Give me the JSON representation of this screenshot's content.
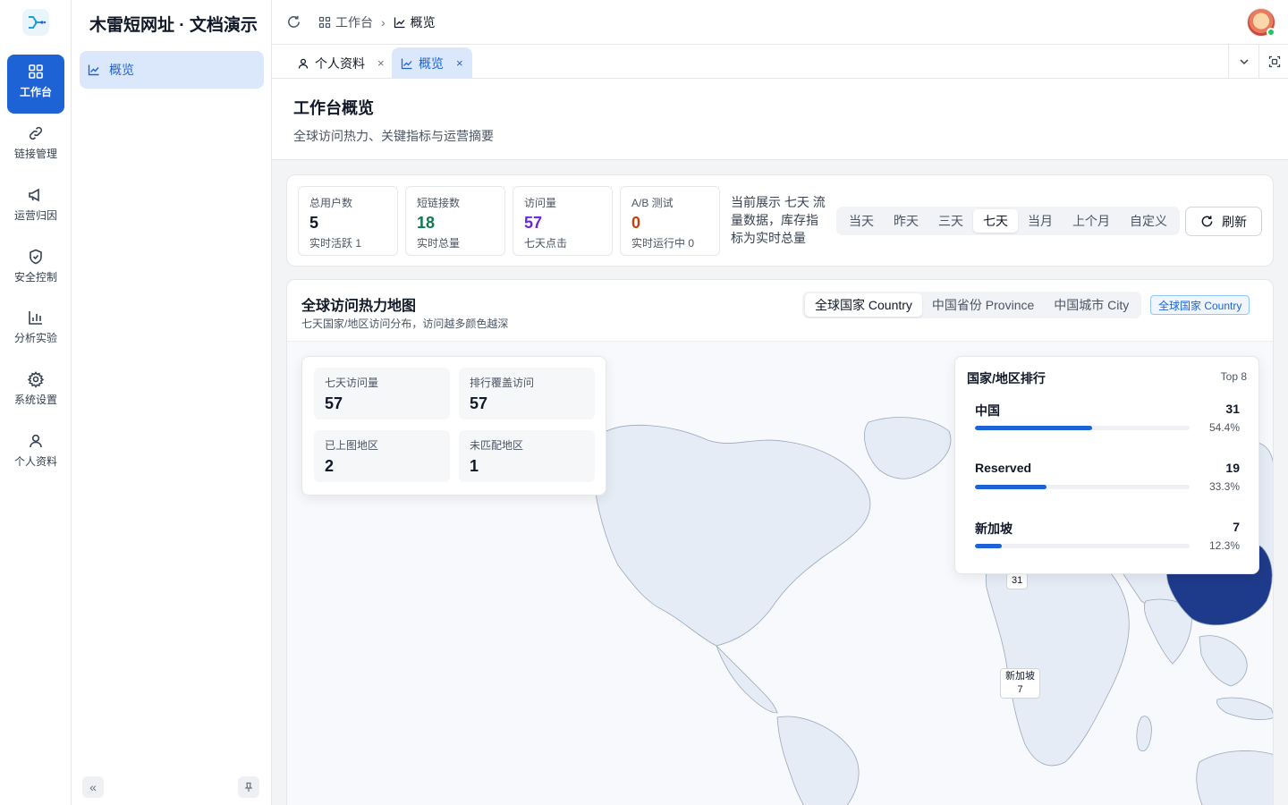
{
  "brand": "木雷短网址 · 文档演示",
  "rail": [
    {
      "label": "工作台",
      "icon": "grid-icon",
      "active": true
    },
    {
      "label": "链接管理",
      "icon": "link-icon"
    },
    {
      "label": "运营归因",
      "icon": "megaphone-icon"
    },
    {
      "label": "安全控制",
      "icon": "shield-icon"
    },
    {
      "label": "分析实验",
      "icon": "bar-chart-icon"
    },
    {
      "label": "系统设置",
      "icon": "gear-icon"
    },
    {
      "label": "个人资料",
      "icon": "user-icon"
    }
  ],
  "sidebar": {
    "menu_item": "概览"
  },
  "header": {
    "crumbs": [
      "工作台",
      "概览"
    ]
  },
  "tabs": [
    {
      "label": "个人资料",
      "close": "×"
    },
    {
      "label": "概览",
      "close": "×"
    }
  ],
  "page": {
    "title": "工作台概览",
    "subtitle": "全球访问热力、关键指标与运营摘要"
  },
  "stats": [
    {
      "label": "总用户数",
      "value": "5",
      "sub": "实时活跃 1",
      "color": "#111827"
    },
    {
      "label": "短链接数",
      "value": "18",
      "sub": "实时总量",
      "color": "#0f7a4d"
    },
    {
      "label": "访问量",
      "value": "57",
      "sub": "七天点击",
      "color": "#6d28d9"
    },
    {
      "label": "A/B 测试",
      "value": "0",
      "sub": "实时运行中 0",
      "color": "#c2410c"
    }
  ],
  "stat_note": "当前展示 七天 流量数据，库存指标为实时总量",
  "ranges": [
    "当天",
    "昨天",
    "三天",
    "七天",
    "当月",
    "上个月",
    "自定义"
  ],
  "ranges_selected": "七天",
  "refresh_label": "刷新",
  "map": {
    "title": "全球访问热力地图",
    "desc": "七天国家/地区访问分布，访问越多颜色越深",
    "scopes": [
      "全球国家 Country",
      "中国省份 Province",
      "中国城市 City"
    ],
    "scope_selected": "全球国家 Country",
    "badge": "全球国家 Country",
    "overview": [
      {
        "label": "七天访问量",
        "value": "57"
      },
      {
        "label": "排行覆盖访问",
        "value": "57"
      },
      {
        "label": "已上图地区",
        "value": "2"
      },
      {
        "label": "未匹配地区",
        "value": "1"
      }
    ],
    "ranking_title": "国家/地区排行",
    "ranking_top": "Top 8",
    "ranking": [
      {
        "name": "中国",
        "count": "31",
        "pct": "54.4%",
        "share": 0.544
      },
      {
        "name": "Reserved",
        "count": "19",
        "pct": "33.3%",
        "share": 0.333
      },
      {
        "name": "新加坡",
        "count": "7",
        "pct": "12.3%",
        "share": 0.123
      }
    ],
    "label_china": "31",
    "label_sg_name": "新加坡",
    "label_sg_count": "7"
  },
  "colors": {
    "accent": "#1e63d6",
    "china_fill": "#1e3a8a",
    "land": "#e6ecf5"
  }
}
